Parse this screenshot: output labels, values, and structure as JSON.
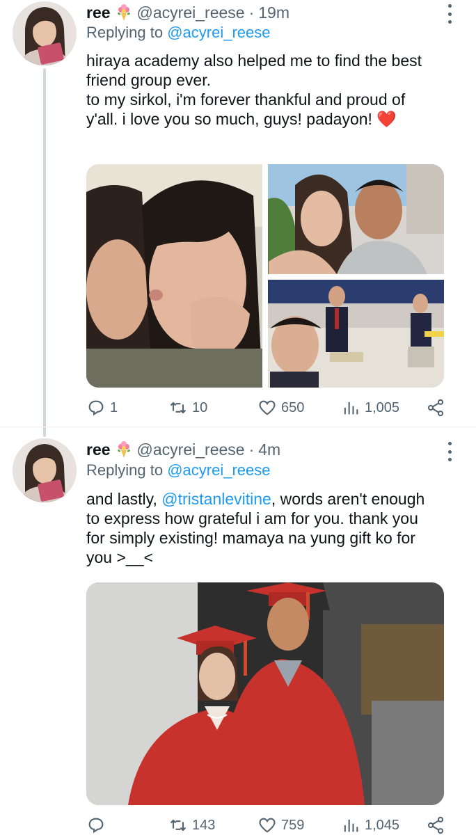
{
  "tweets": [
    {
      "display_name": "ree",
      "name_emoji": "bouquet-icon",
      "handle": "@acyrei_reese",
      "separator": "·",
      "time": "19m",
      "replying_prefix": "Replying to ",
      "replying_to": "@acyrei_reese",
      "text_lines": [
        "hiraya academy also helped me to find the best",
        "friend group ever.",
        "to my sirkol, i'm forever thankful and proud of",
        "y'all. i love you so much, guys! padayon! "
      ],
      "heart": "❤️",
      "stats": {
        "replies": "1",
        "retweets": "10",
        "likes": "650",
        "views": "1,005"
      }
    },
    {
      "display_name": "ree",
      "name_emoji": "bouquet-icon",
      "handle": "@acyrei_reese",
      "separator": "·",
      "time": "4m",
      "replying_prefix": "Replying to ",
      "replying_to": "@acyrei_reese",
      "text_prefix": "and lastly, ",
      "mention": "@tristanlevitine",
      "text_first_suffix": ", words aren't enough",
      "text_lines": [
        "to express how grateful i am for you. thank you",
        "for simply existing! mamaya na yung gift ko for",
        "you >__<"
      ],
      "stats": {
        "replies": "",
        "retweets": "143",
        "likes": "759",
        "views": "1,045"
      }
    }
  ],
  "colors": {
    "link": "#1d9bf0",
    "secondary_text": "#536471",
    "primary_text": "#0f1419",
    "graduation_gown": "#c8322d"
  }
}
